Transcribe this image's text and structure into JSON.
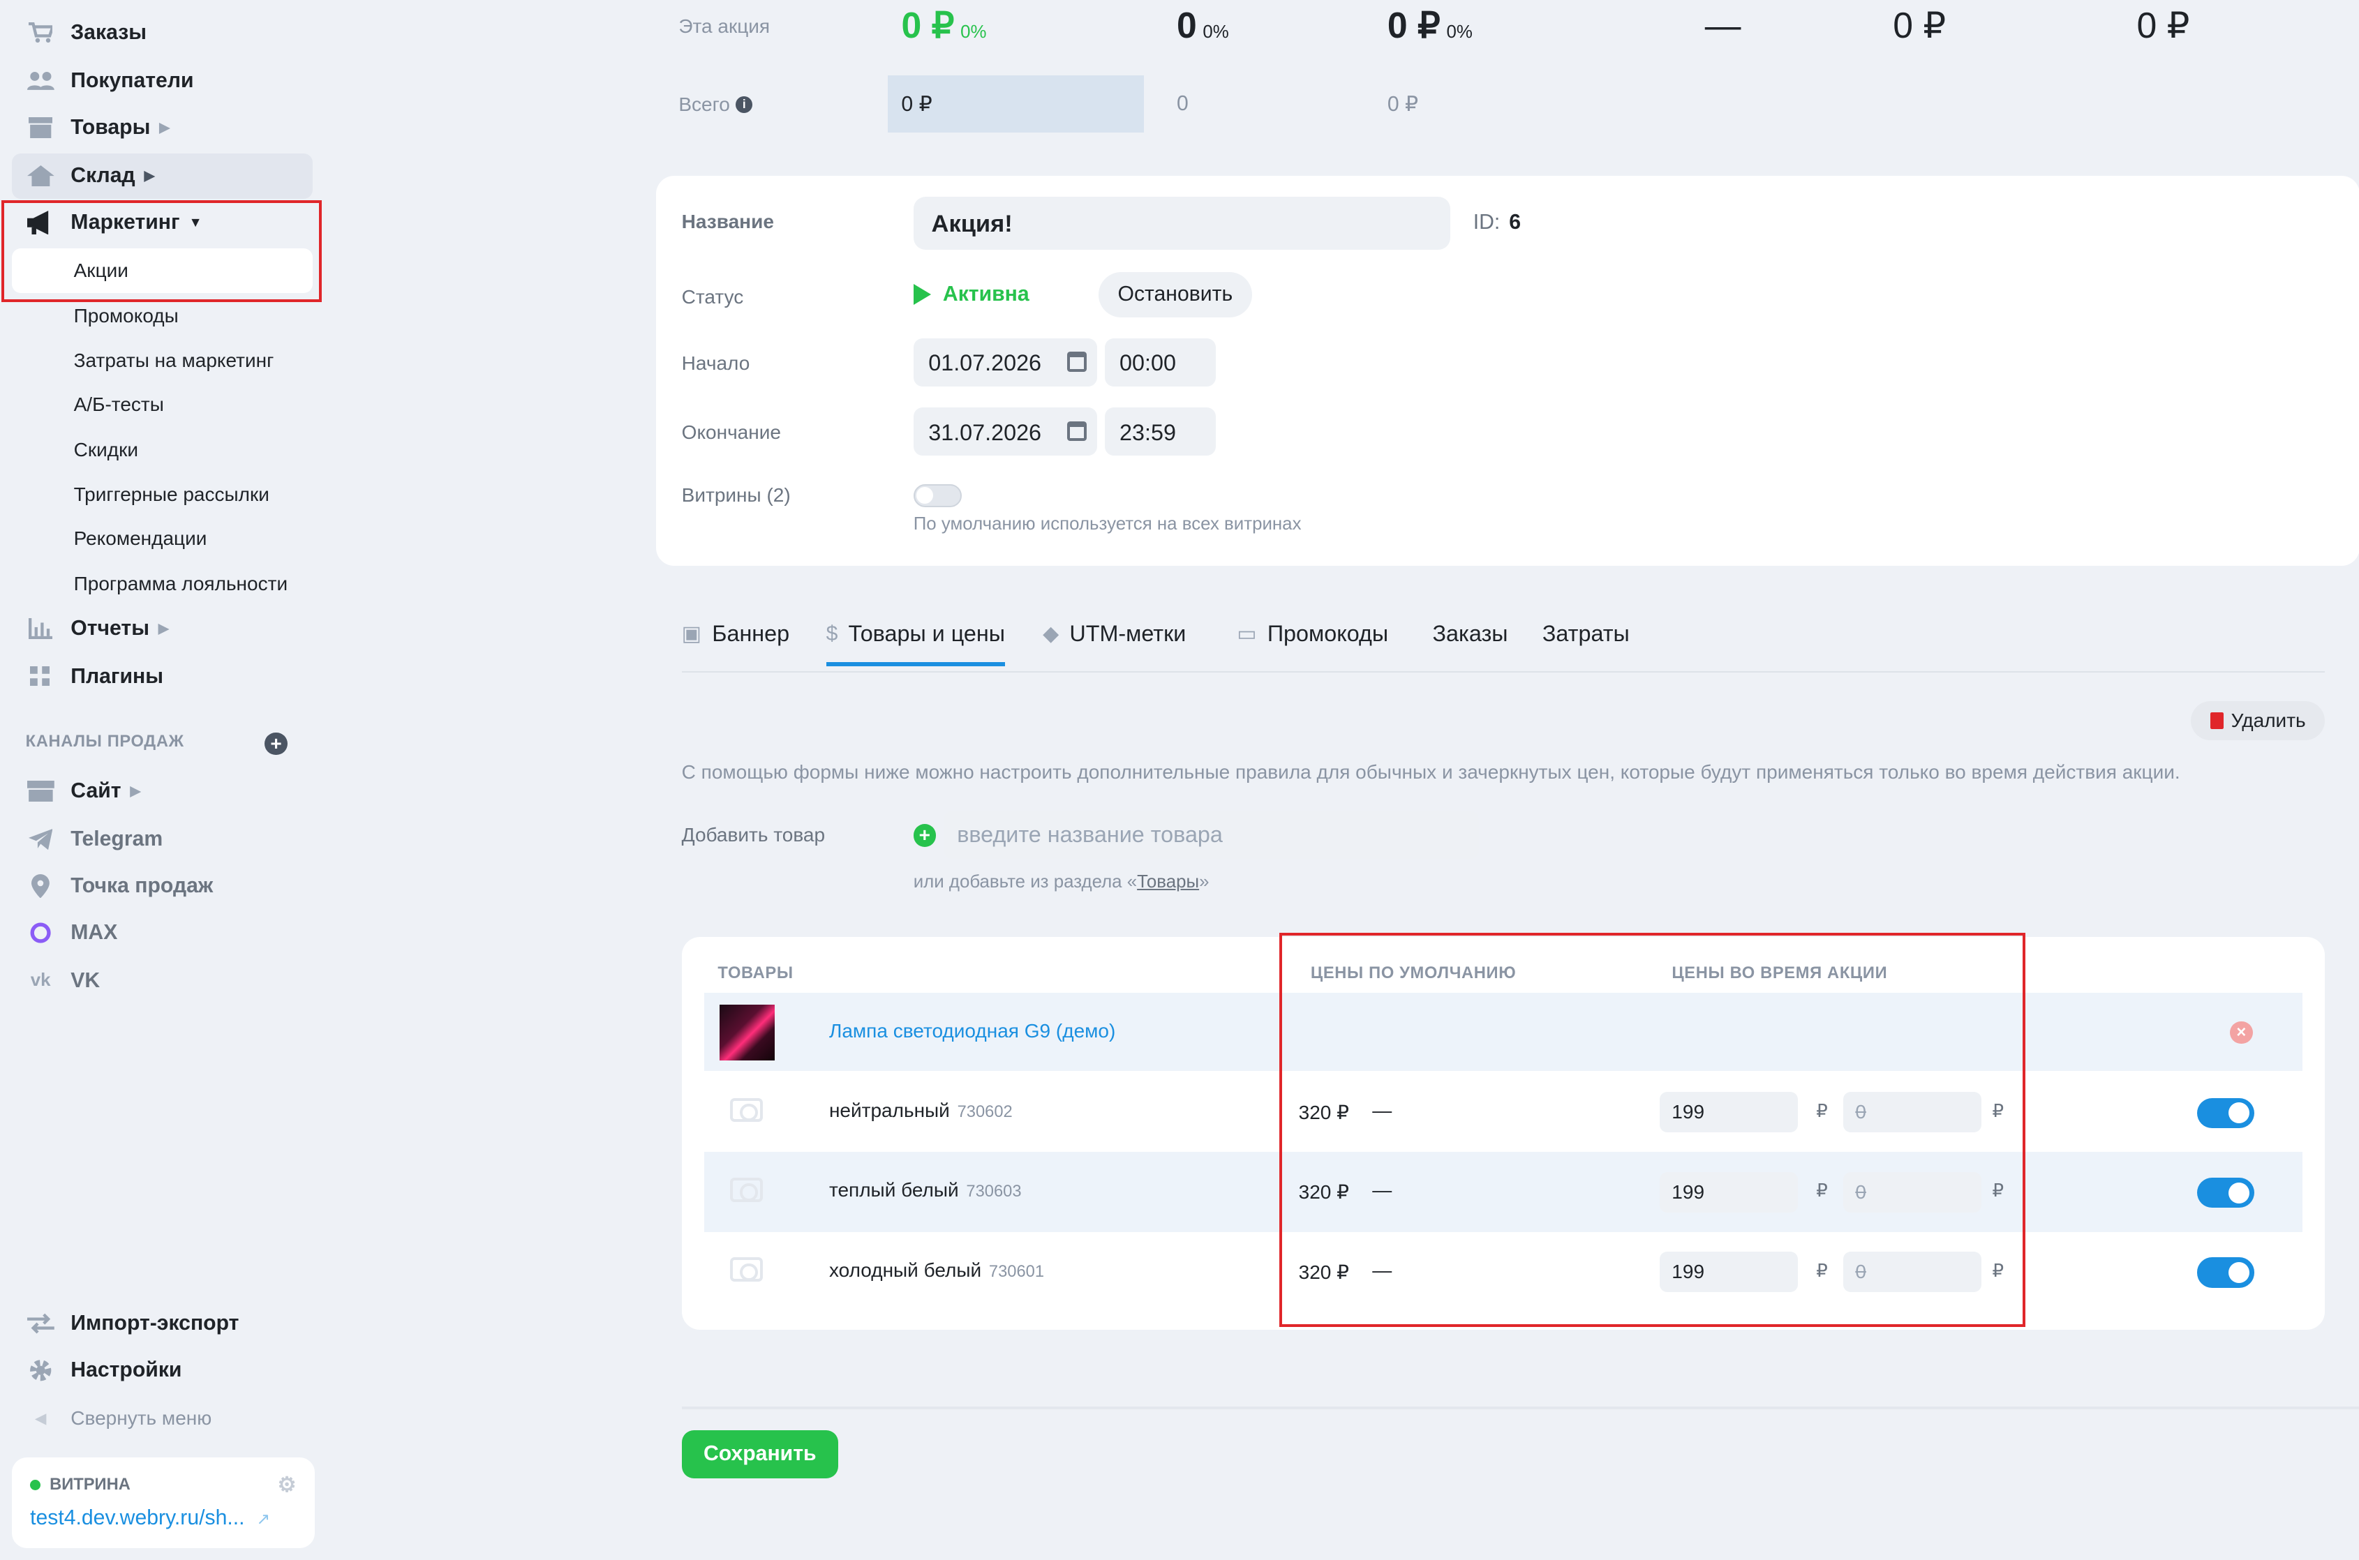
{
  "sidebar": {
    "items": [
      {
        "label": "Заказы",
        "icon": "cart-icon"
      },
      {
        "label": "Покупатели",
        "icon": "users-icon"
      },
      {
        "label": "Товары",
        "icon": "box-icon"
      },
      {
        "label": "Склад",
        "icon": "warehouse-icon"
      },
      {
        "label": "Маркетинг",
        "icon": "megaphone-icon"
      }
    ],
    "marketing_sub": [
      "Акции",
      "Промокоды",
      "Затраты на маркетинг",
      "А/Б-тесты",
      "Скидки",
      "Триггерные рассылки",
      "Рекомендации",
      "Программа лояльности"
    ],
    "items2": [
      {
        "label": "Отчеты",
        "icon": "bar-chart-icon"
      },
      {
        "label": "Плагины",
        "icon": "puzzle-icon"
      }
    ],
    "channels_title": "КАНАЛЫ ПРОДАЖ",
    "channels": [
      {
        "label": "Сайт",
        "icon": "store-icon"
      },
      {
        "label": "Telegram",
        "icon": "telegram-icon"
      },
      {
        "label": "Точка продаж",
        "icon": "pin-icon"
      },
      {
        "label": "MAX",
        "icon": "max-icon"
      },
      {
        "label": "VK",
        "icon": "vk-icon"
      }
    ],
    "bottom": [
      {
        "label": "Импорт-экспорт",
        "icon": "swap-icon"
      },
      {
        "label": "Настройки",
        "icon": "gear-icon"
      },
      {
        "label": "Свернуть меню",
        "icon": "chevron-left-icon"
      }
    ],
    "storefront_label": "ВИТРИНА",
    "storefront_url": "test4.dev.webry.ru/sh..."
  },
  "stats": {
    "this_label": "Эта акция",
    "this_revenue": "0 ₽",
    "this_revenue_pct": "0%",
    "this_orders": "0",
    "this_orders_pct": "0%",
    "this_third": "0 ₽",
    "this_third_pct": "0%",
    "this_dash": "—",
    "this_c5": "0 ₽",
    "this_c6": "0 ₽",
    "total_label": "Всего",
    "total_revenue": "0 ₽",
    "total_orders": "0",
    "total_third": "0 ₽"
  },
  "form": {
    "name_label": "Название",
    "name_value": "Акция!",
    "id_label": "ID:",
    "id_value": "6",
    "status_label": "Статус",
    "status_value": "Активна",
    "stop_button": "Остановить",
    "start_label": "Начало",
    "start_date": "01.07.2026",
    "start_time": "00:00",
    "end_label": "Окончание",
    "end_date": "31.07.2026",
    "end_time": "23:59",
    "storefronts_label": "Витрины (2)",
    "storefronts_hint": "По умолчанию используется на всех витринах"
  },
  "tabs": [
    "Баннер",
    "Товары и цены",
    "UTM-метки",
    "Промокоды",
    "Заказы",
    "Затраты"
  ],
  "products": {
    "delete_button": "Удалить",
    "description": "С помощью формы ниже можно настроить дополнительные правила для обычных и зачеркнутых цен, которые будут применяться только во время действия акции.",
    "add_label": "Добавить товар",
    "add_placeholder": "введите название товара",
    "or_add_prefix": "или добавьте из раздела «",
    "or_add_link": "Товары",
    "or_add_suffix": "»",
    "col_products": "ТОВАРЫ",
    "col_default": "ЦЕНЫ ПО УМОЛЧАНИЮ",
    "col_promo": "ЦЕНЫ ВО ВРЕМЯ АКЦИИ",
    "product_name": "Лампа светодиодная G9 (демо)",
    "currency": "₽",
    "variants": [
      {
        "name": "нейтральный",
        "sku": "730602",
        "price": "320 ₽",
        "compare": "—",
        "promo_price": "199",
        "promo_compare": "0"
      },
      {
        "name": "теплый белый",
        "sku": "730603",
        "price": "320 ₽",
        "compare": "—",
        "promo_price": "199",
        "promo_compare": "0"
      },
      {
        "name": "холодный белый",
        "sku": "730601",
        "price": "320 ₽",
        "compare": "—",
        "promo_price": "199",
        "promo_compare": "0"
      }
    ]
  },
  "save_button": "Сохранить",
  "colors": {
    "accent": "#1a8fe0",
    "success": "#27c24c",
    "danger": "#e0262a"
  }
}
